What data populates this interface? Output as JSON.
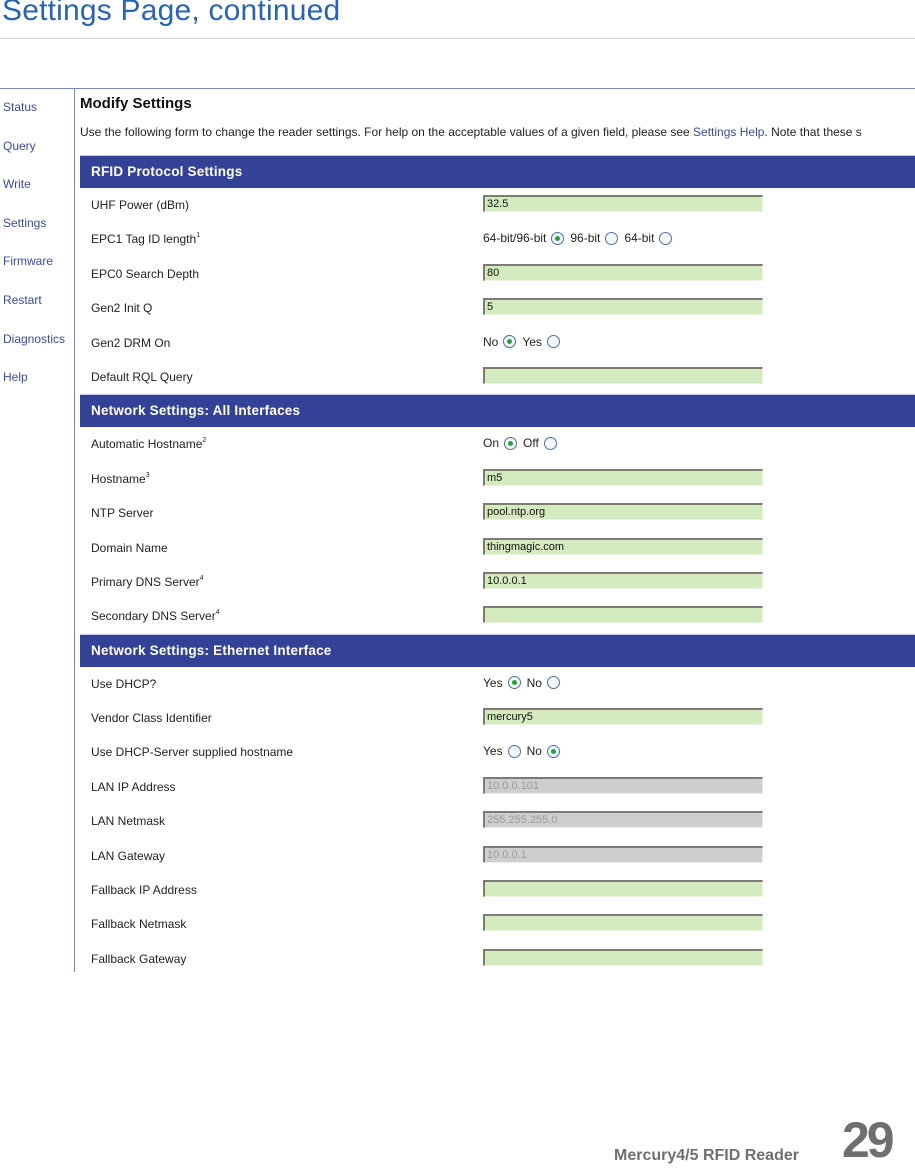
{
  "document": {
    "title": "Settings Page, continued",
    "footer_product": "Mercury4/5 RFID Reader",
    "footer_page_number": "29"
  },
  "sidebar": {
    "items": [
      {
        "label": "Status"
      },
      {
        "label": "Query"
      },
      {
        "label": "Write"
      },
      {
        "label": "Settings"
      },
      {
        "label": "Firmware"
      },
      {
        "label": "Restart"
      },
      {
        "label": "Diagnostics"
      },
      {
        "label": "Help"
      }
    ]
  },
  "main": {
    "heading": "Modify Settings",
    "intro_before": "Use the following form to change the reader settings. For help on the acceptable values of a given field, please see ",
    "intro_link": "Settings Help",
    "intro_after": ". Note that these s"
  },
  "sections": [
    {
      "title": "RFID Protocol Settings",
      "rows": [
        {
          "label": "UHF Power (dBm)",
          "sup": "",
          "type": "text",
          "value": "32.5"
        },
        {
          "label": "EPC1 Tag ID length",
          "sup": "1",
          "type": "radio",
          "options": [
            {
              "label": "64-bit/96-bit",
              "checked": true
            },
            {
              "label": "96-bit",
              "checked": false
            },
            {
              "label": "64-bit",
              "checked": false
            }
          ]
        },
        {
          "label": "EPC0 Search Depth",
          "sup": "",
          "type": "text",
          "value": "80"
        },
        {
          "label": "Gen2 Init Q",
          "sup": "",
          "type": "text",
          "value": "5"
        },
        {
          "label": "Gen2 DRM On",
          "sup": "",
          "type": "radio",
          "options": [
            {
              "label": "No",
              "checked": true
            },
            {
              "label": "Yes",
              "checked": false
            }
          ]
        },
        {
          "label": "Default RQL Query",
          "sup": "",
          "type": "text",
          "value": ""
        }
      ]
    },
    {
      "title": "Network Settings: All Interfaces",
      "rows": [
        {
          "label": "Automatic Hostname",
          "sup": "2",
          "type": "radio",
          "options": [
            {
              "label": "On",
              "checked": true
            },
            {
              "label": "Off",
              "checked": false
            }
          ]
        },
        {
          "label": "Hostname",
          "sup": "3",
          "type": "text",
          "value": "m5"
        },
        {
          "label": "NTP Server",
          "sup": "",
          "type": "text",
          "value": "pool.ntp.org"
        },
        {
          "label": "Domain Name",
          "sup": "",
          "type": "text",
          "value": "thingmagic.com"
        },
        {
          "label": "Primary DNS Server",
          "sup": "4",
          "type": "text",
          "value": "10.0.0.1"
        },
        {
          "label": "Secondary DNS Server",
          "sup": "4",
          "type": "text",
          "value": ""
        }
      ]
    },
    {
      "title": "Network Settings: Ethernet Interface",
      "rows": [
        {
          "label": "Use DHCP?",
          "sup": "",
          "type": "radio",
          "options": [
            {
              "label": "Yes",
              "checked": true
            },
            {
              "label": "No",
              "checked": false
            }
          ]
        },
        {
          "label": "Vendor Class Identifier",
          "sup": "",
          "type": "text",
          "value": "mercury5"
        },
        {
          "label": "Use DHCP-Server supplied hostname",
          "sup": "",
          "type": "radio",
          "options": [
            {
              "label": "Yes",
              "checked": false
            },
            {
              "label": "No",
              "checked": true
            }
          ]
        },
        {
          "label": "LAN IP Address",
          "sup": "",
          "type": "text",
          "value": "10.0.0.101",
          "disabled": true
        },
        {
          "label": "LAN Netmask",
          "sup": "",
          "type": "text",
          "value": "255.255.255.0",
          "disabled": true
        },
        {
          "label": "LAN Gateway",
          "sup": "",
          "type": "text",
          "value": "10.0.0.1",
          "disabled": true
        },
        {
          "label": "Fallback IP Address",
          "sup": "",
          "type": "text",
          "value": ""
        },
        {
          "label": "Fallback Netmask",
          "sup": "",
          "type": "text",
          "value": ""
        },
        {
          "label": "Fallback Gateway",
          "sup": "",
          "type": "text",
          "value": ""
        }
      ]
    }
  ],
  "colors": {
    "title_blue": "#2a63b3",
    "section_header_bg": "#334296",
    "link_blue": "#3a4aa0",
    "field_bg": "#d3ebbe",
    "field_disabled_bg": "#cecece",
    "radio_dot": "#27a23a"
  }
}
